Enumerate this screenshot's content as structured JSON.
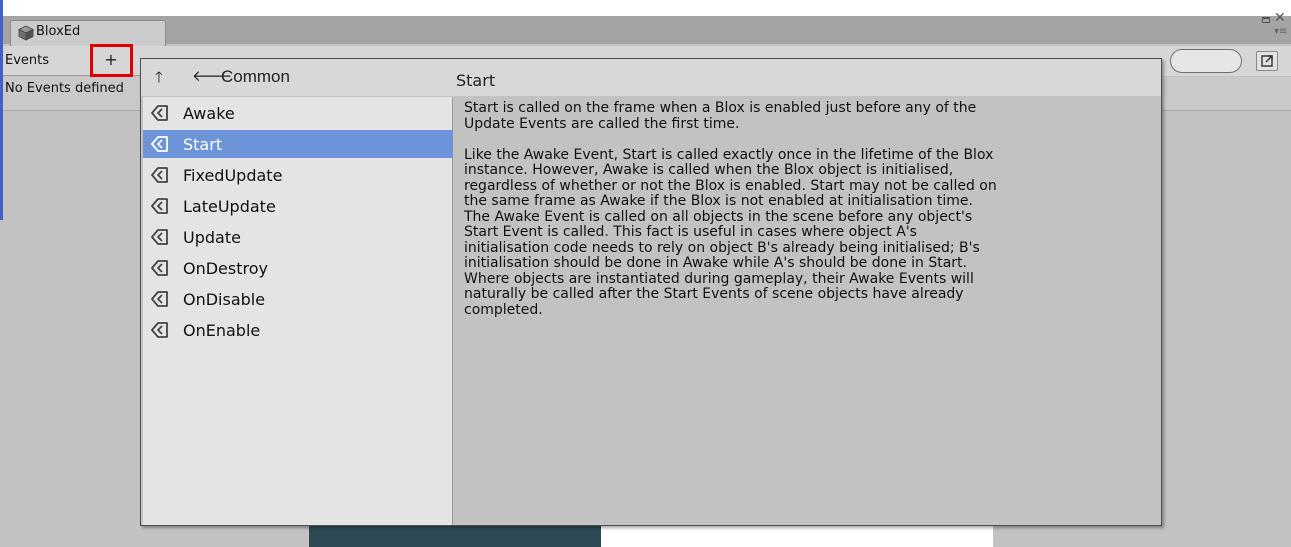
{
  "window": {
    "tab_title": "BloxEd"
  },
  "toolbar": {
    "events_label": "Events",
    "add_label": "+"
  },
  "info": {
    "no_events_text": "No Events defined"
  },
  "popup": {
    "breadcrumb": "Common",
    "detail_title": "Start",
    "items": [
      {
        "label": "Awake",
        "selected": false
      },
      {
        "label": "Start",
        "selected": true
      },
      {
        "label": "FixedUpdate",
        "selected": false
      },
      {
        "label": "LateUpdate",
        "selected": false
      },
      {
        "label": "Update",
        "selected": false
      },
      {
        "label": "OnDestroy",
        "selected": false
      },
      {
        "label": "OnDisable",
        "selected": false
      },
      {
        "label": "OnEnable",
        "selected": false
      }
    ],
    "description": "Start is called on the frame when a Blox is enabled just before any of the\nUpdate Events are called the first time.\n\nLike the Awake Event, Start is called exactly once in the lifetime of the Blox\ninstance. However, Awake is called when the Blox object is initialised,\nregardless of whether or not the Blox is enabled. Start may not be called on\nthe same frame as Awake if the Blox is not enabled at initialisation time.\nThe Awake Event is called on all objects in the scene before any object's\nStart Event is called. This fact is useful in cases where object A's\ninitialisation code needs to rely on object B's already being initialised; B's\ninitialisation should be done in Awake while A's should be done in Start.\nWhere objects are instantiated during gameplay, their Awake Events will\nnaturally be called after the Start Events of scene objects have already\ncompleted."
  },
  "colors": {
    "selection": "#6d94d9",
    "highlight_box": "#e00000"
  }
}
